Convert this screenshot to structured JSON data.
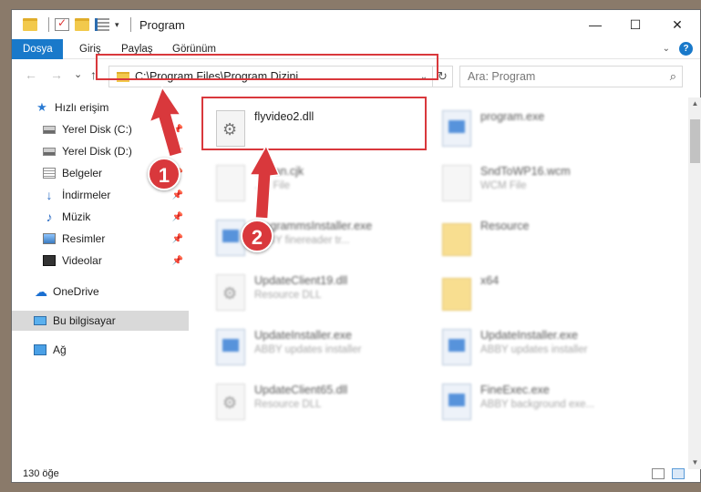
{
  "window": {
    "title": "Program",
    "controls": {
      "minimize": "—",
      "maximize": "☐",
      "close": "✕"
    }
  },
  "ribbon": {
    "tabs": [
      {
        "label": "Dosya",
        "active": true
      },
      {
        "label": "Giriş"
      },
      {
        "label": "Paylaş"
      },
      {
        "label": "Görünüm"
      }
    ],
    "help": "?"
  },
  "nav": {
    "back": "←",
    "forward": "→",
    "recent": "⌄",
    "up": "↑",
    "address": "C:\\Program Files\\Program Dizini",
    "search_placeholder": "Ara: Program"
  },
  "sidebar": {
    "items": [
      {
        "label": "Hızlı erişim",
        "icon": "star-icon"
      },
      {
        "label": "Yerel Disk (C:)",
        "icon": "drive-icon",
        "pinned": true
      },
      {
        "label": "Yerel Disk (D:)",
        "icon": "drive-icon",
        "pinned": true
      },
      {
        "label": "Belgeler",
        "icon": "documents-icon",
        "pinned": true
      },
      {
        "label": "İndirmeler",
        "icon": "downloads-icon",
        "pinned": true
      },
      {
        "label": "Müzik",
        "icon": "music-icon",
        "pinned": true
      },
      {
        "label": "Resimler",
        "icon": "pictures-icon",
        "pinned": true
      },
      {
        "label": "Videolar",
        "icon": "videos-icon",
        "pinned": true
      },
      {
        "label": "OneDrive",
        "icon": "cloud-icon"
      },
      {
        "label": "Bu bilgisayar",
        "icon": "computer-icon",
        "selected": true
      },
      {
        "label": "Ağ",
        "icon": "network-icon"
      }
    ]
  },
  "files": [
    {
      "name": "flyvideo2.dll",
      "desc": "",
      "icon": "dll-gear-icon",
      "highlighted": true
    },
    {
      "name": "program.exe",
      "desc": "",
      "icon": "exe-icon"
    },
    {
      "name": "...rean.cjk",
      "desc": "...K File",
      "icon": "file-icon"
    },
    {
      "name": "SndToWP16.wcm",
      "desc": "WCM File",
      "icon": "file-icon"
    },
    {
      "name": "...ogrammsInstaller.exe",
      "desc": "ABBY finereader tr...",
      "icon": "exe-icon"
    },
    {
      "name": "Resource",
      "desc": "",
      "icon": "folder-icon"
    },
    {
      "name": "UpdateClient19.dll",
      "desc": "Resource DLL",
      "icon": "dll-gear-icon"
    },
    {
      "name": "x64",
      "desc": "",
      "icon": "folder-icon"
    },
    {
      "name": "UpdateInstaller.exe",
      "desc": "ABBY updates installer",
      "icon": "exe-icon"
    },
    {
      "name": "UpdateInstaller.exe",
      "desc": "ABBY updates installer",
      "icon": "exe-icon"
    },
    {
      "name": "UpdateClient65.dll",
      "desc": "Resource DLL",
      "icon": "dll-gear-icon"
    },
    {
      "name": "FineExec.exe",
      "desc": "ABBY background exe...",
      "icon": "exe-icon"
    }
  ],
  "status": {
    "count": "130 öğe"
  },
  "callouts": [
    {
      "label": "1"
    },
    {
      "label": "2"
    }
  ],
  "colors": {
    "accent": "#1979ca",
    "highlight": "#d9383c"
  }
}
